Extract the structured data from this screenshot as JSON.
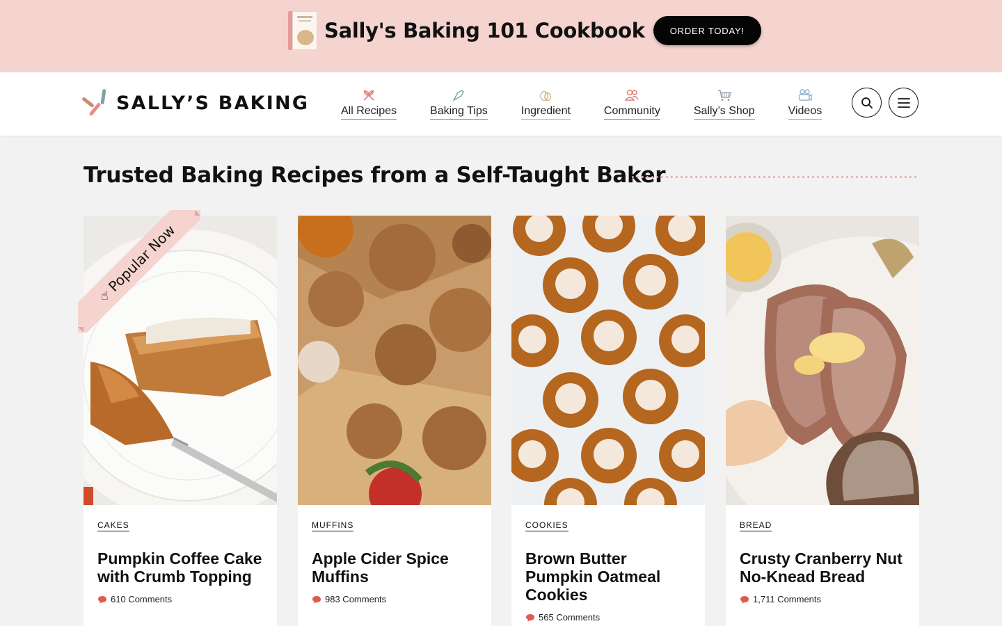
{
  "promo": {
    "title": "Sally's Baking 101 Cookbook",
    "button": "ORDER TODAY!",
    "background": "#f5d3cf"
  },
  "header": {
    "logo_text": "SALLY’S BAKING",
    "nav": [
      {
        "label": "All Recipes",
        "icon": "whisk-icon"
      },
      {
        "label": "Baking Tips",
        "icon": "pastry-bag-icon"
      },
      {
        "label": "Ingredient",
        "icon": "eggs-icon"
      },
      {
        "label": "Community",
        "icon": "people-icon"
      },
      {
        "label": "Sally’s Shop",
        "icon": "shopping-cart-icon"
      },
      {
        "label": "Videos",
        "icon": "video-camera-icon"
      }
    ],
    "search_icon": "search-icon",
    "menu_icon": "hamburger-menu-icon"
  },
  "section": {
    "title": "Trusted Baking Recipes from a Self-Taught Baker"
  },
  "ribbon": {
    "label": "Popular Now",
    "icon": "pointing-hand-icon"
  },
  "cards": [
    {
      "category": "CAKES",
      "title": "Pumpkin Coffee Cake with Crumb Topping",
      "comments": "610 Comments",
      "image": "pumpkin coffee cake slice on white plate"
    },
    {
      "category": "MUFFINS",
      "title": "Apple Cider Spice Muffins",
      "comments": "983 Comments",
      "image": "cinnamon sugar muffins with apple"
    },
    {
      "category": "COOKIES",
      "title": "Brown Butter Pumpkin Oatmeal Cookies",
      "comments": "565 Comments",
      "image": "iced pumpkin oatmeal cookies"
    },
    {
      "category": "BREAD",
      "title": "Crusty Cranberry Nut No-Knead Bread",
      "comments": "1,711 Comments",
      "image": "sliced cranberry nut bread with butter"
    }
  ],
  "colors": {
    "accent_pink": "#f5d3cf",
    "comment_bubble": "#e05a4f",
    "text": "#111111"
  }
}
